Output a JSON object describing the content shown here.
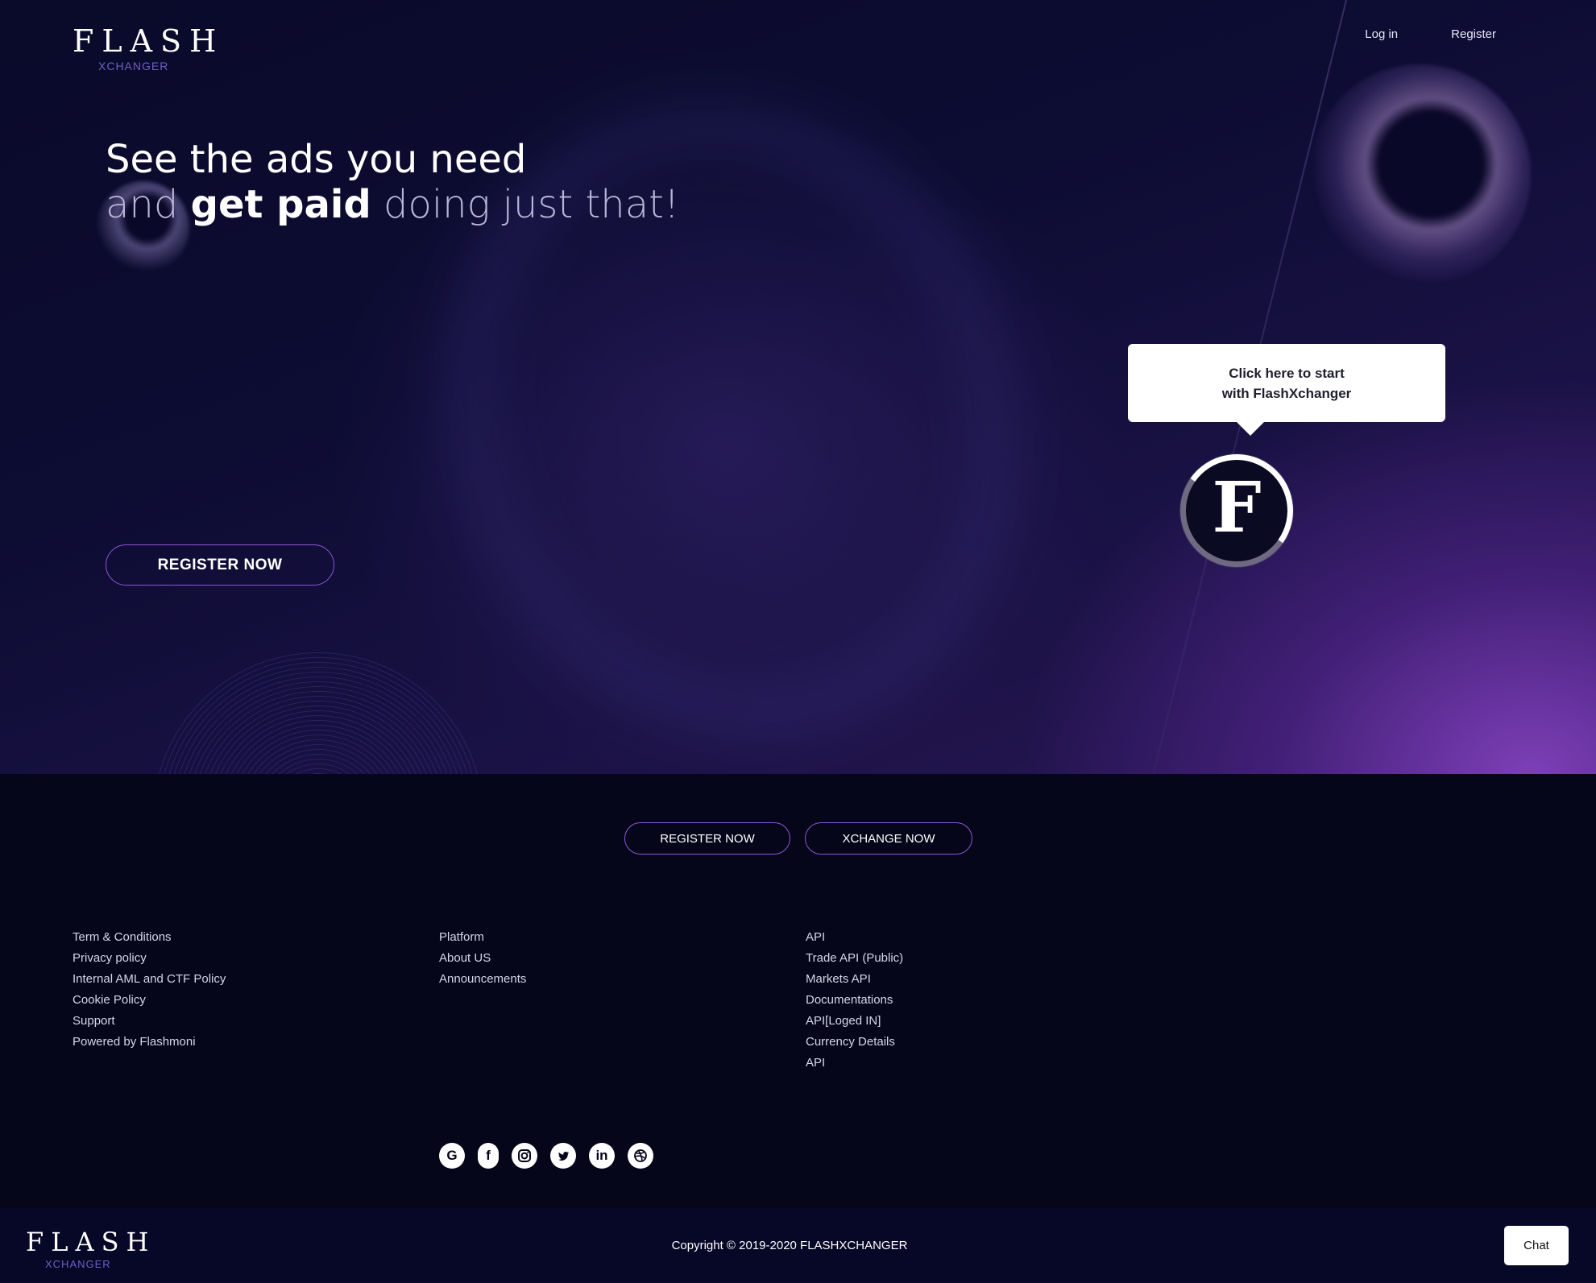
{
  "brand": {
    "name": "FLASH",
    "sub": "XCHANGER"
  },
  "nav": {
    "login": "Log in",
    "register": "Register"
  },
  "hero": {
    "line1": "See the ads you need",
    "line2_and": "and",
    "line2_bold": "get paid",
    "line2_rest": "doing just that!",
    "register_btn": "REGISTER NOW",
    "tooltip_line1": "Click here to start",
    "tooltip_line2": "with FlashXchanger",
    "badge_letter": "F"
  },
  "cta": {
    "register": "REGISTER NOW",
    "xchange": "XCHANGE NOW"
  },
  "links": {
    "col1": [
      "Term & Conditions",
      "Privacy policy",
      "Internal AML and CTF Policy",
      "Cookie Policy",
      "Support",
      "Powered by Flashmoni"
    ],
    "col2": [
      "Platform",
      "About US",
      "Announcements"
    ],
    "col3": [
      "API",
      "Trade API (Public)",
      "Markets API",
      "Documentations",
      "API[Loged IN]",
      "Currency Details",
      "API"
    ]
  },
  "social": {
    "icons": [
      "google-icon",
      "facebook-icon",
      "instagram-icon",
      "twitter-icon",
      "linkedin-icon",
      "dribbble-icon"
    ],
    "glyphs": {
      "google": "G",
      "facebook": "f",
      "linkedin": "in"
    }
  },
  "footer": {
    "copyright": "Copyright © 2019-2020 FLASHXCHANGER",
    "chat": "Chat"
  },
  "colors": {
    "accent": "#8f56d4",
    "bg_dark": "#06061a",
    "bottom_bar": "#070728"
  }
}
